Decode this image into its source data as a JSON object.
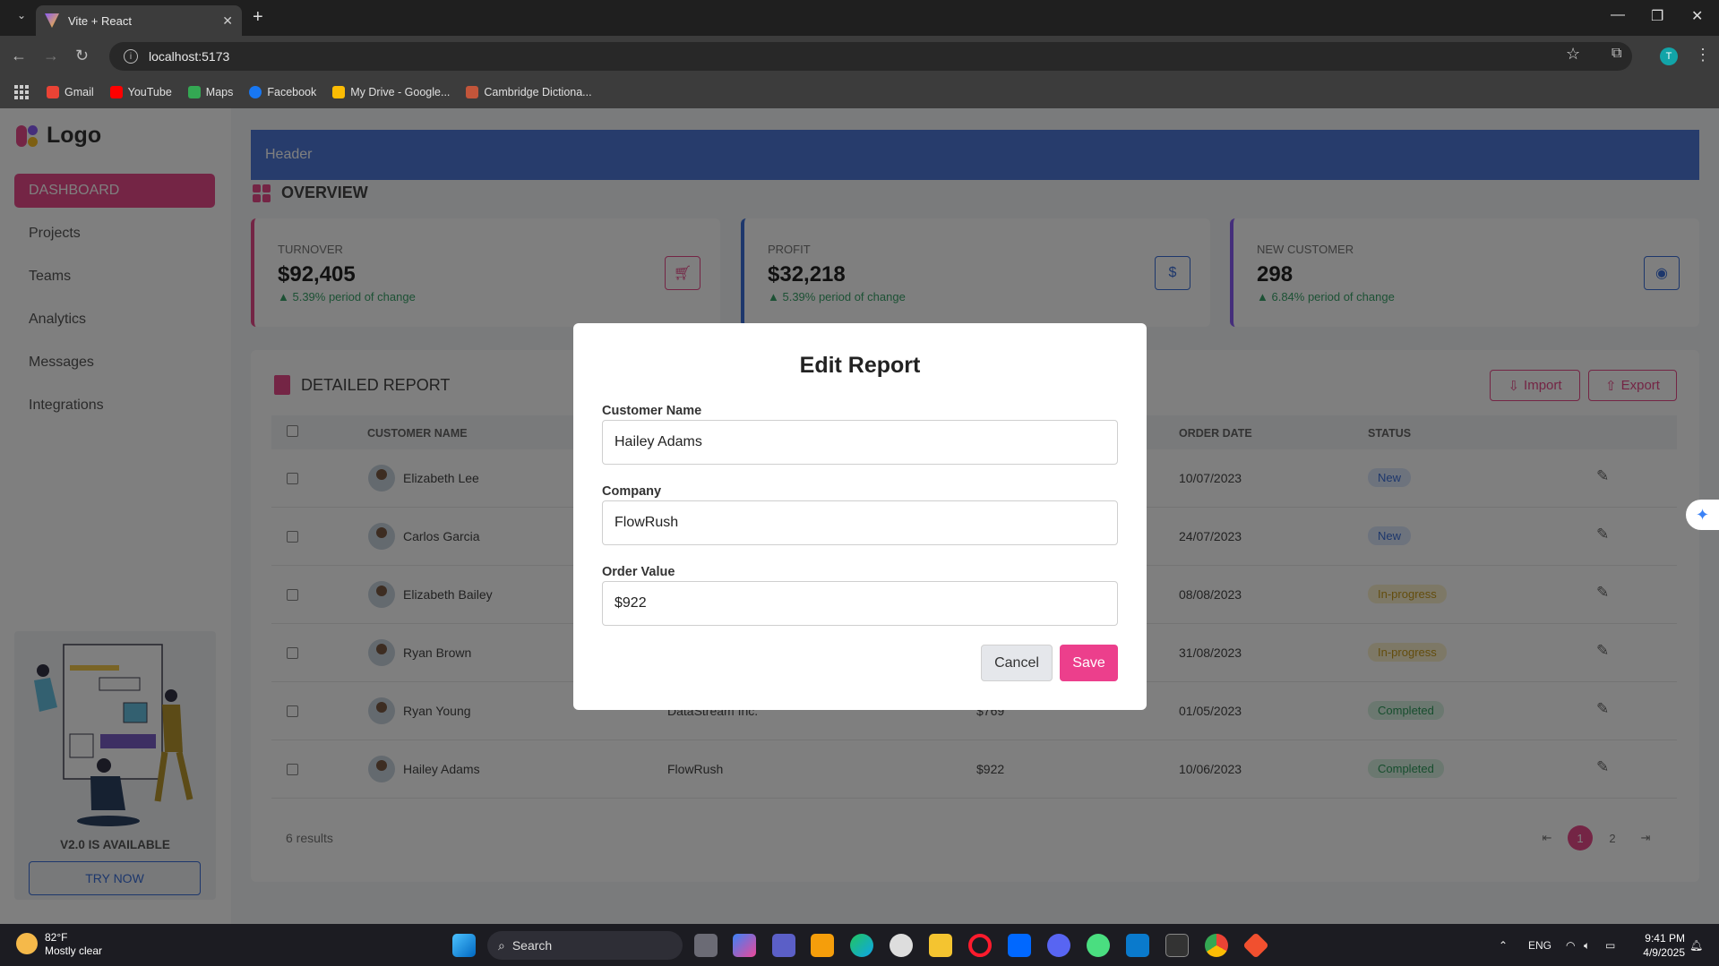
{
  "browser": {
    "tab_title": "Vite + React",
    "url": "localhost:5173",
    "profile_initial": "T",
    "bookmarks": [
      "Gmail",
      "YouTube",
      "Maps",
      "Facebook",
      "My Drive - Google...",
      "Cambridge Dictiona..."
    ]
  },
  "sidebar": {
    "logo": "Logo",
    "items": [
      "DASHBOARD",
      "Projects",
      "Teams",
      "Analytics",
      "Messages",
      "Integrations"
    ],
    "promo_text": "V2.0 IS AVAILABLE",
    "promo_button": "TRY NOW"
  },
  "header": {
    "title": "Header"
  },
  "overview": {
    "title": "OVERVIEW",
    "cards": [
      {
        "label": "TURNOVER",
        "value": "$92,405",
        "change": "▲ 5.39% period of change",
        "color": "#e84a8a",
        "icon": "cart-icon"
      },
      {
        "label": "PROFIT",
        "value": "$32,218",
        "change": "▲ 5.39% period of change",
        "color": "#3b6fd8",
        "icon": "dollar-icon"
      },
      {
        "label": "NEW CUSTOMER",
        "value": "298",
        "change": "▲ 6.84% period of change",
        "color": "#8b5cf6",
        "icon": "user-circle-icon"
      }
    ]
  },
  "report": {
    "title": "DETAILED REPORT",
    "import_label": "Import",
    "export_label": "Export",
    "columns": [
      "CUSTOMER NAME",
      "ORDER DATE",
      "STATUS"
    ],
    "rows": [
      {
        "name": "Elizabeth Lee",
        "company": "",
        "value": "",
        "date": "10/07/2023",
        "status": "New"
      },
      {
        "name": "Carlos Garcia",
        "company": "",
        "value": "",
        "date": "24/07/2023",
        "status": "New"
      },
      {
        "name": "Elizabeth Bailey",
        "company": "",
        "value": "",
        "date": "08/08/2023",
        "status": "In-progress"
      },
      {
        "name": "Ryan Brown",
        "company": "",
        "value": "",
        "date": "31/08/2023",
        "status": "In-progress"
      },
      {
        "name": "Ryan Young",
        "company": "DataStream Inc.",
        "value": "$769",
        "date": "01/05/2023",
        "status": "Completed"
      },
      {
        "name": "Hailey Adams",
        "company": "FlowRush",
        "value": "$922",
        "date": "10/06/2023",
        "status": "Completed"
      }
    ],
    "results_text": "6 results",
    "pages": [
      "1",
      "2"
    ],
    "current_page": "1"
  },
  "modal": {
    "title": "Edit Report",
    "fields": [
      {
        "label": "Customer Name",
        "value": "Hailey Adams"
      },
      {
        "label": "Company",
        "value": "FlowRush"
      },
      {
        "label": "Order Value",
        "value": "$922"
      }
    ],
    "cancel_label": "Cancel",
    "save_label": "Save"
  },
  "taskbar": {
    "temperature": "82°F",
    "weather": "Mostly clear",
    "search_label": "Search",
    "lang": "ENG",
    "time": "9:41 PM",
    "date": "4/9/2025"
  }
}
